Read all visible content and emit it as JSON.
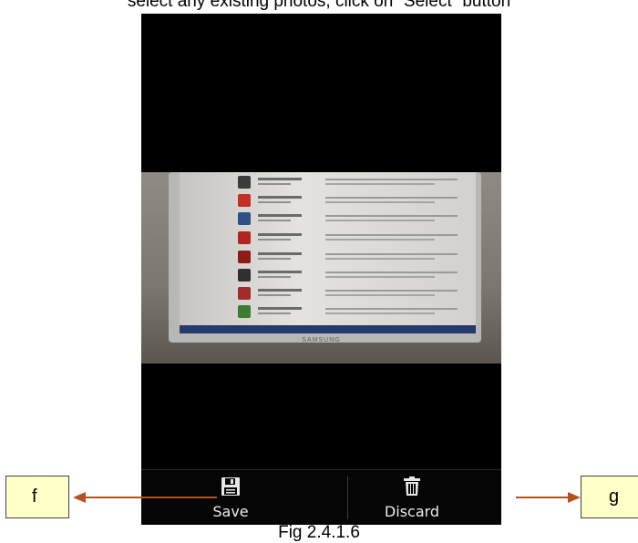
{
  "top_text": "select any existing photos, click on “Select” button",
  "toolbar": {
    "save_label": "Save",
    "discard_label": "Discard"
  },
  "callouts": {
    "left": "f",
    "right": "g"
  },
  "monitor_brand": "SAMSUNG",
  "caption": "Fig 2.4.1.6",
  "colors": {
    "callout_fill": "#ffffc8",
    "arrow": "#b5531f",
    "toolbar_bg": "#050505"
  },
  "icons": [
    "save-icon",
    "trash-icon"
  ]
}
